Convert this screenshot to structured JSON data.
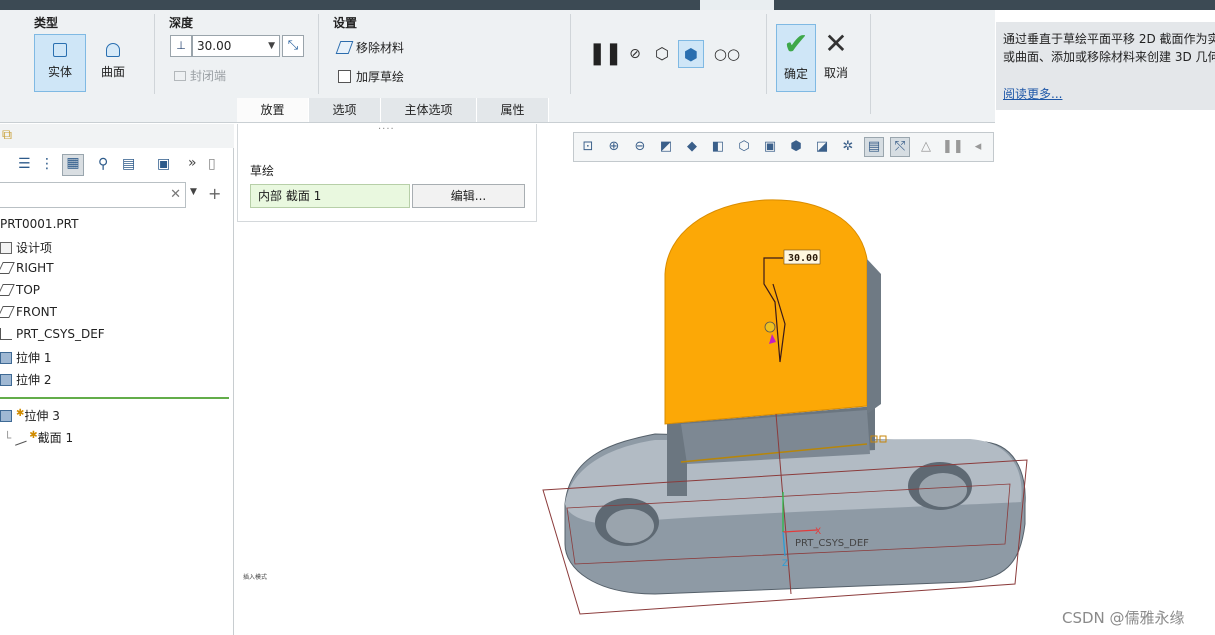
{
  "ribbon": {
    "type_group": {
      "title": "类型",
      "solid_label": "实体",
      "surface_label": "曲面"
    },
    "depth_group": {
      "title": "深度",
      "depth_value": "30.00",
      "closed_end_label": "封闭端"
    },
    "settings_group": {
      "title": "设置",
      "remove_material_label": "移除材料",
      "thicken_sketch_label": "加厚草绘"
    },
    "ok_label": "确定",
    "cancel_label": "取消"
  },
  "help": {
    "line1": "通过垂直于草绘平面平移 2D 截面作为实",
    "line2": "或曲面、添加或移除材料来创建 3D 几何",
    "read_more": "阅读更多..."
  },
  "sub_tabs": [
    {
      "label": "放置"
    },
    {
      "label": "选项"
    },
    {
      "label": "主体选项"
    },
    {
      "label": "属性"
    }
  ],
  "placement_panel": {
    "sketch_label": "草绘",
    "sketch_collector_value": "内部 截面 1",
    "edit_button_label": "编辑..."
  },
  "model_tree": {
    "items": [
      {
        "label": "PRT0001.PRT"
      },
      {
        "label": "设计项"
      },
      {
        "label": "RIGHT"
      },
      {
        "label": "TOP"
      },
      {
        "label": "FRONT"
      },
      {
        "label": "PRT_CSYS_DEF"
      },
      {
        "label": "拉伸 1"
      },
      {
        "label": "拉伸 2"
      },
      {
        "label": "拉伸 3"
      },
      {
        "label": "截面 1"
      }
    ]
  },
  "graphics": {
    "dimension_value": "30.00",
    "csys_label": "PRT_CSYS_DEF",
    "insert_mode_label": "插入模式",
    "colors": {
      "preview_orange": "#fca806",
      "part_gray": "#8d9aa6",
      "datum_plane": "#8b3b3b"
    }
  },
  "watermark": "CSDN @儒雅永缘"
}
